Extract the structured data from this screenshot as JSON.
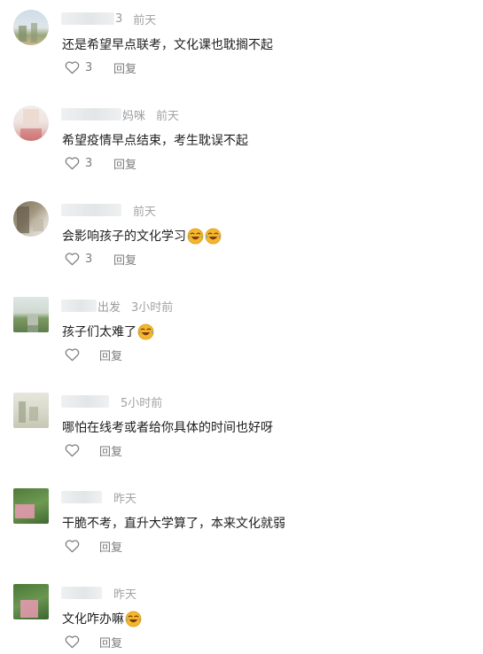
{
  "comments": [
    {
      "name_tail": "3",
      "time": "前天",
      "text": "还是希望早点联考，文化课也耽搁不起",
      "emojis": 0,
      "likes": "3",
      "reply_label": "回复"
    },
    {
      "name_tail": "妈咪",
      "time": "前天",
      "text": "希望疫情早点结束，考生耽误不起",
      "emojis": 0,
      "likes": "3",
      "reply_label": "回复"
    },
    {
      "name_tail": "",
      "time": "前天",
      "text": "会影响孩子的文化学习",
      "emojis": 2,
      "likes": "3",
      "reply_label": "回复"
    },
    {
      "name_tail": "出发",
      "time": "3小时前",
      "text": "孩子们太难了",
      "emojis": 1,
      "likes": "",
      "reply_label": "回复"
    },
    {
      "name_tail": "",
      "time": "5小时前",
      "text": "哪怕在线考或者给你具体的时间也好呀",
      "emojis": 0,
      "likes": "",
      "reply_label": "回复"
    },
    {
      "name_tail": "",
      "time": "昨天",
      "text": "干脆不考，直升大学算了，本来文化就弱",
      "emojis": 0,
      "likes": "",
      "reply_label": "回复"
    },
    {
      "name_tail": "",
      "time": "昨天",
      "text": "文化咋办嘛",
      "emojis": 1,
      "likes": "",
      "reply_label": "回复"
    }
  ],
  "icons": {
    "like": "heart-outline-icon",
    "emoji": "laugh-cry-emoji-icon"
  },
  "colors": {
    "time": "#a3a3a3",
    "text": "#1e1e1e",
    "action": "#7c7c7c",
    "emoji_face": "#f4b62c"
  }
}
